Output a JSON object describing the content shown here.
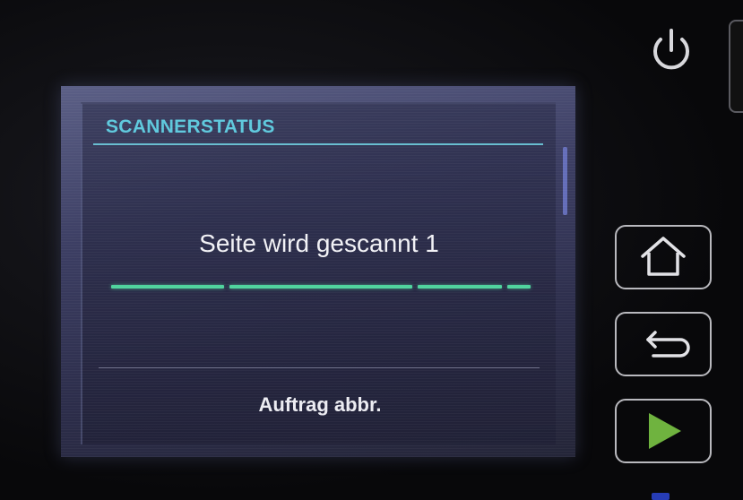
{
  "screen": {
    "title": "SCANNERSTATUS",
    "status_message": "Seite wird gescannt 1",
    "progress": {
      "state": "indeterminate",
      "color": "#4fd39d"
    },
    "cancel_label": "Auftrag abbr."
  },
  "hardware": {
    "power_icon": "power-icon",
    "home_icon": "home-icon",
    "back_icon": "back-arrow-icon",
    "start_icon": "play-icon",
    "start_color": "#6fb33f"
  },
  "colors": {
    "title": "#5ec9dd",
    "screen_bg": "#3c3e63"
  }
}
